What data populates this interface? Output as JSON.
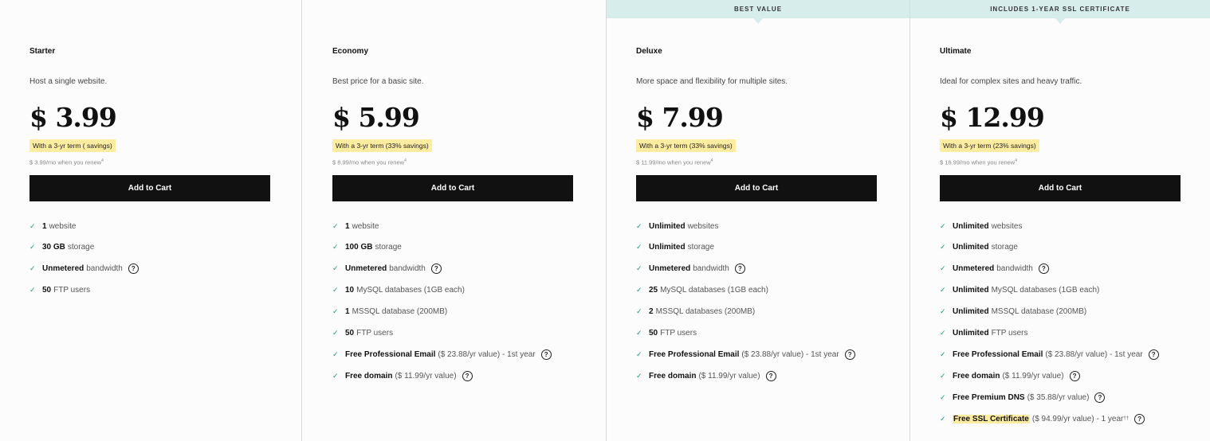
{
  "plans": [
    {
      "ribbon": "",
      "name": "Starter",
      "description": "Host a single website.",
      "price": "$ 3.99",
      "savings": "With a 3-yr term ( savings)",
      "renew": "$ 3.99/mo when you renew",
      "renew_note": "4",
      "cta": "Add to Cart",
      "features": [
        {
          "bold": "1",
          "text": "website",
          "help": false
        },
        {
          "bold": "30 GB",
          "text": "storage",
          "help": false
        },
        {
          "bold": "Unmetered",
          "text": "bandwidth",
          "help": true
        },
        {
          "bold": "50",
          "text": "FTP users",
          "help": false
        }
      ]
    },
    {
      "ribbon": "",
      "name": "Economy",
      "description": "Best price for a basic site.",
      "price": "$ 5.99",
      "savings": "With a 3-yr term (33% savings)",
      "renew": "$ 8.99/mo when you renew",
      "renew_note": "4",
      "cta": "Add to Cart",
      "features": [
        {
          "bold": "1",
          "text": "website",
          "help": false
        },
        {
          "bold": "100 GB",
          "text": "storage",
          "help": false
        },
        {
          "bold": "Unmetered",
          "text": "bandwidth",
          "help": true
        },
        {
          "bold": "10",
          "text": "MySQL databases (1GB each)",
          "help": false
        },
        {
          "bold": "1",
          "text": "MSSQL database (200MB)",
          "help": false
        },
        {
          "bold": "50",
          "text": "FTP users",
          "help": false
        },
        {
          "bold": "Free Professional Email",
          "text": "($ 23.88/yr value) - 1st year",
          "help": true
        },
        {
          "bold": "Free domain",
          "text": "($ 11.99/yr value)",
          "help": true
        }
      ]
    },
    {
      "ribbon": "BEST VALUE",
      "name": "Deluxe",
      "description": "More space and flexibility for multiple sites.",
      "price": "$ 7.99",
      "savings": "With a 3-yr term (33% savings)",
      "renew": "$ 11.99/mo when you renew",
      "renew_note": "4",
      "cta": "Add to Cart",
      "features": [
        {
          "bold": "Unlimited",
          "text": "websites",
          "help": false
        },
        {
          "bold": "Unlimited",
          "text": "storage",
          "help": false
        },
        {
          "bold": "Unmetered",
          "text": "bandwidth",
          "help": true
        },
        {
          "bold": "25",
          "text": "MySQL databases (1GB each)",
          "help": false
        },
        {
          "bold": "2",
          "text": "MSSQL databases (200MB)",
          "help": false
        },
        {
          "bold": "50",
          "text": "FTP users",
          "help": false
        },
        {
          "bold": "Free Professional Email",
          "text": "($ 23.88/yr value) - 1st year",
          "help": true
        },
        {
          "bold": "Free domain",
          "text": "($ 11.99/yr value)",
          "help": true
        }
      ]
    },
    {
      "ribbon": "INCLUDES 1-YEAR SSL CERTIFICATE",
      "name": "Ultimate",
      "description": "Ideal for complex sites and heavy traffic.",
      "price": "$ 12.99",
      "savings": "With a 3-yr term (23% savings)",
      "renew": "$ 16.99/mo when you renew",
      "renew_note": "4",
      "cta": "Add to Cart",
      "features": [
        {
          "bold": "Unlimited",
          "text": "websites",
          "help": false
        },
        {
          "bold": "Unlimited",
          "text": "storage",
          "help": false
        },
        {
          "bold": "Unmetered",
          "text": "bandwidth",
          "help": true
        },
        {
          "bold": "Unlimited",
          "text": "MySQL databases (1GB each)",
          "help": false
        },
        {
          "bold": "Unlimited",
          "text": "MSSQL database (200MB)",
          "help": false
        },
        {
          "bold": "Unlimited",
          "text": "FTP users",
          "help": false
        },
        {
          "bold": "Free Professional Email",
          "text": "($ 23.88/yr value) - 1st year",
          "help": true
        },
        {
          "bold": "Free domain",
          "text": "($ 11.99/yr value)",
          "help": true
        },
        {
          "bold": "Free Premium DNS",
          "text": "($ 35.88/yr value)",
          "help": true
        },
        {
          "bold": "Free SSL Certificate",
          "text": "($ 94.99/yr value) - 1 year",
          "note": "††",
          "help": true,
          "highlight": true
        }
      ]
    }
  ],
  "icons": {
    "check": "✓",
    "help": "?"
  }
}
